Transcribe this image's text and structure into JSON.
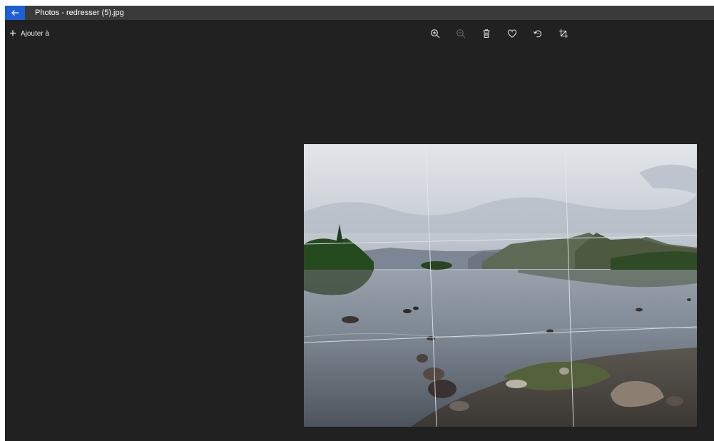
{
  "titlebar": {
    "back_icon": "arrow-left-icon",
    "title": "Photos - redresser (5).jpg"
  },
  "actions": {
    "add_label": "Ajouter à",
    "add_icon": "plus-icon"
  },
  "toolbar": {
    "tools": [
      {
        "icon": "zoom-in-icon",
        "enabled": true
      },
      {
        "icon": "zoom-out-icon",
        "enabled": false
      },
      {
        "icon": "trash-icon",
        "enabled": true
      },
      {
        "icon": "heart-icon",
        "enabled": true
      },
      {
        "icon": "rotate-icon",
        "enabled": true
      },
      {
        "icon": "crop-icon",
        "enabled": true
      }
    ]
  },
  "photo": {
    "subject": "lake-landscape-photo",
    "grid_overlay": true
  },
  "colors": {
    "background": "#212121",
    "titlebar": "#3a3a3a",
    "accent": "#1f5fd6"
  }
}
